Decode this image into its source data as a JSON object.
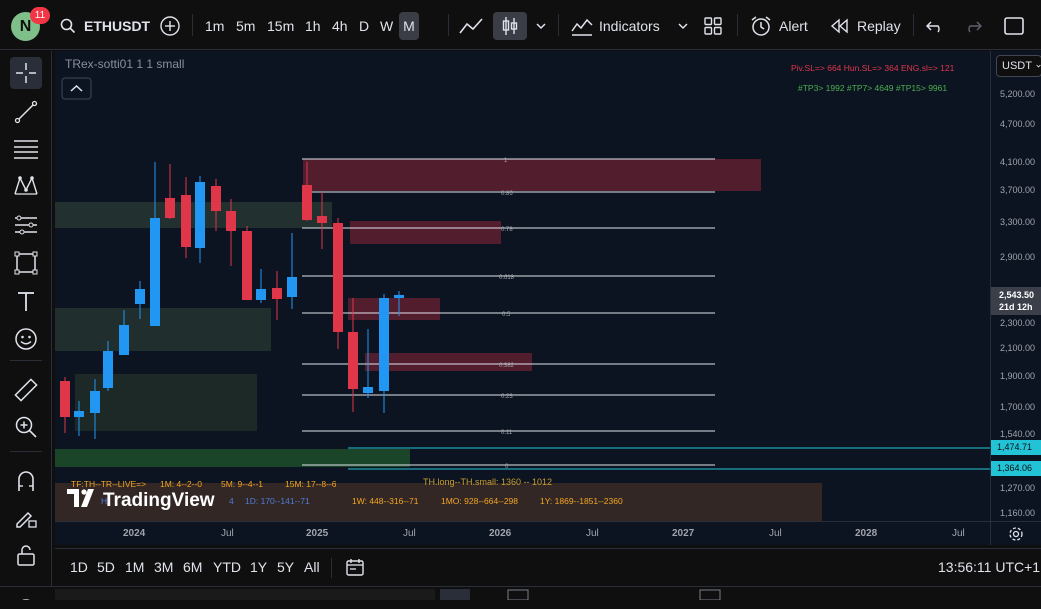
{
  "header": {
    "avatar_letter": "N",
    "notification_count": "11",
    "symbol": "ETHUSDT",
    "timeframes": [
      "1m",
      "5m",
      "15m",
      "1h",
      "4h",
      "D",
      "W",
      "M"
    ],
    "active_timeframe": "M",
    "indicators_label": "Indicators",
    "alert_label": "Alert",
    "replay_label": "Replay"
  },
  "chart": {
    "indicator_title": "TRex-sotti01 1 1 small",
    "currency": "USDT",
    "top_info_line1": "Piv.SL=> 664  Hun.SL=> 364  ENG.sl=> 121",
    "top_info_line2": "#TP3> 1992  #TP7> 4649  #TP15> 9961",
    "fib_labels": [
      "1",
      "0.86",
      "0.78",
      "0.618",
      "0.5",
      "0.382",
      "0.23",
      "0.11",
      "0"
    ],
    "th_label": "TH.long--TH.small: 1360 -- 1012",
    "tf_live": "TF:TH--TR--LIVE=>",
    "tf_1m": "1M: 4--2--0",
    "tf_5m": "5M: 9--4--1",
    "tf_15m": "15M: 17--8--6",
    "tf_1d_prefix": "H",
    "tf_1d_suffix": "4",
    "tf_1d": "1D: 170--141--71",
    "tf_1w": "1W: 448--316--71",
    "tf_1mo": "1MO: 928--664--298",
    "tf_1y": "1Y: 1869--1851--2360",
    "watermark": "TradingView",
    "current_price": "2,543.50",
    "countdown": "21d 12h",
    "line_label_1": "1,474.71",
    "line_label_2": "1,364.06"
  },
  "yaxis": {
    "ticks": [
      "5,200.00",
      "4,700.00",
      "4,100.00",
      "3,700.00",
      "3,300.00",
      "2,900.00",
      "2,300.00",
      "2,100.00",
      "1,900.00",
      "1,700.00",
      "1,540.00",
      "1,270.00",
      "1,160.00"
    ]
  },
  "xaxis": {
    "ticks": [
      "2024",
      "Jul",
      "2025",
      "Jul",
      "2026",
      "Jul",
      "2027",
      "Jul",
      "2028",
      "Jul"
    ]
  },
  "bottom": {
    "ranges": [
      "1D",
      "5D",
      "1M",
      "3M",
      "6M",
      "YTD",
      "1Y",
      "5Y",
      "All"
    ],
    "clock": "13:56:11 UTC+1"
  },
  "colors": {
    "up": "#2196f3",
    "down": "#e0364a",
    "background": "#0d1421"
  }
}
